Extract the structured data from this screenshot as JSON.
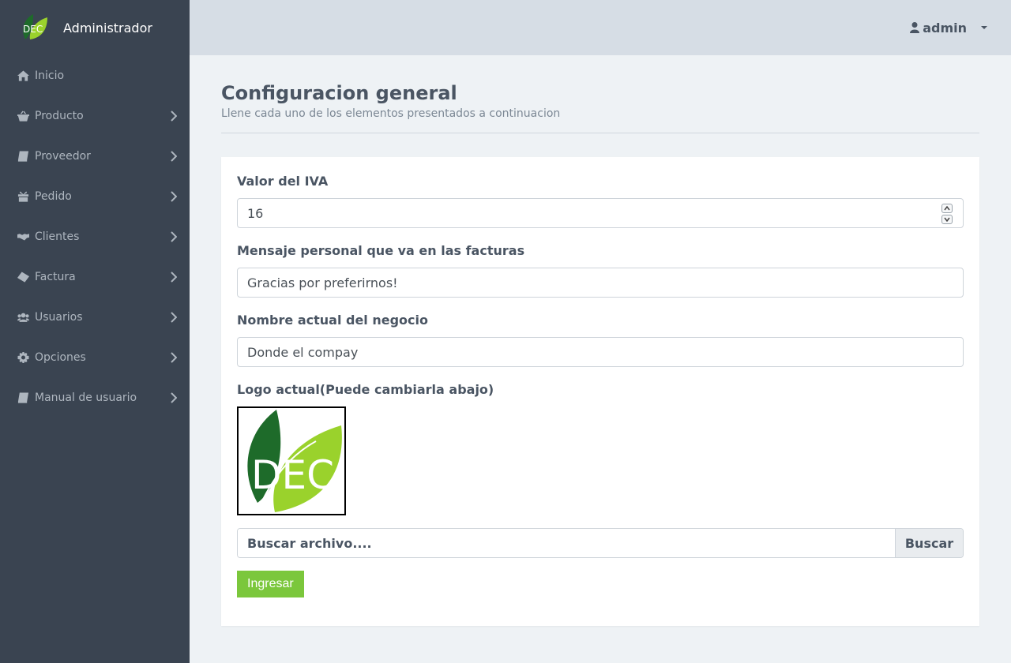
{
  "brand": {
    "title": "Administrador",
    "logo_text": "DEC"
  },
  "sidebar": {
    "items": [
      {
        "label": "Inicio",
        "icon": "home-icon",
        "has_submenu": false
      },
      {
        "label": "Producto",
        "icon": "basket-icon",
        "has_submenu": true
      },
      {
        "label": "Proveedor",
        "icon": "book-icon",
        "has_submenu": true
      },
      {
        "label": "Pedido",
        "icon": "gift-icon",
        "has_submenu": true
      },
      {
        "label": "Clientes",
        "icon": "handshake-icon",
        "has_submenu": true
      },
      {
        "label": "Factura",
        "icon": "ticket-icon",
        "has_submenu": true
      },
      {
        "label": "Usuarios",
        "icon": "users-icon",
        "has_submenu": true
      },
      {
        "label": "Opciones",
        "icon": "gear-icon",
        "has_submenu": true
      },
      {
        "label": "Manual de usuario",
        "icon": "book-icon",
        "has_submenu": true
      }
    ]
  },
  "topbar": {
    "user_name": "admin"
  },
  "page": {
    "title": "Configuracion general",
    "subtitle": "Llene cada uno de los elementos presentados a continuacion"
  },
  "form": {
    "iva_label": "Valor del IVA",
    "iva_value": "16",
    "message_label": "Mensaje personal que va en las facturas",
    "message_value": "Gracias por preferirnos!",
    "business_label": "Nombre actual del negocio",
    "business_value": "Donde el compay",
    "logo_label": "Logo actual(Puede cambiarla abajo)",
    "logo_text": "DEC",
    "file_placeholder": "Buscar archivo....",
    "file_button": "Buscar",
    "submit_label": "Ingresar"
  },
  "colors": {
    "sidebar_bg": "#3a4451",
    "topbar_bg": "#d6dde5",
    "content_bg": "#eef2f5",
    "accent_green": "#7bc73c",
    "logo_dark_green": "#1e6b2a",
    "logo_light_green": "#9ad22c"
  }
}
